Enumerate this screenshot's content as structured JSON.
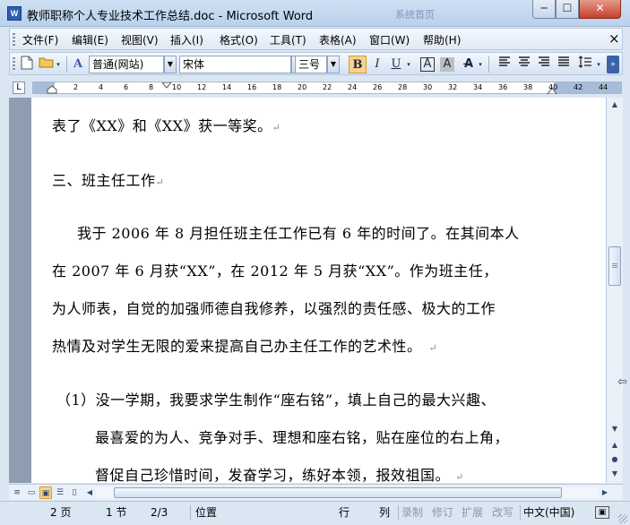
{
  "window": {
    "title": "教师职称个人专业技术工作总结.doc - Microsoft Word",
    "app_icon": "W",
    "bg_ghost": "系统首页",
    "min_label": "─",
    "max_label": "☐",
    "close_label": "✕"
  },
  "menu": {
    "items": [
      "文件(F)",
      "编辑(E)",
      "视图(V)",
      "插入(I)",
      "格式(O)",
      "工具(T)",
      "表格(A)",
      "窗口(W)",
      "帮助(H)"
    ],
    "close_label": "×"
  },
  "toolbar": {
    "style_value": "普通(网站)",
    "font_value": "宋体",
    "size_value": "三号",
    "bold": "B",
    "italic": "I",
    "underline": "U",
    "char_border": "A",
    "char_shading": "A"
  },
  "ruler": {
    "tab_glyph": "L",
    "numbers": [
      "2",
      "4",
      "6",
      "8",
      "10",
      "12",
      "14",
      "16",
      "18",
      "20",
      "22",
      "24",
      "26",
      "28",
      "30",
      "32",
      "34",
      "36",
      "38",
      "40",
      "42",
      "44"
    ]
  },
  "document": {
    "paragraph_mark": "↵",
    "lines": [
      "表了《XX》和《XX》获一等奖。",
      "三、班主任工作",
      "我于 2006 年 8 月担任班主任工作已有 6 年的时间了。在其间本人",
      "在 2007 年 6 月获“XX”，在 2012 年 5 月获“XX”。作为班主任，",
      "为人师表，自觉的加强师德自我修养，以强烈的责任感、极大的工作",
      "热情及对学生无限的爱来提高自己办主任工作的艺术性。",
      "（1）没一学期，我要求学生制作“座右铭”，填上自己的最大兴趣、",
      "最喜爱的为人、竞争对手、理想和座右铭，贴在座位的右上角，",
      "督促自己珍惜时间，发奋学习，练好本领，报效祖国。"
    ]
  },
  "statusbar": {
    "page": "2 页",
    "section": "1 节",
    "page_of": "2/3",
    "position": "位置",
    "line": "行",
    "column": "列",
    "rec": "录制",
    "trk": "修订",
    "ext": "扩展",
    "ovr": "改写",
    "language": "中文(中国)"
  }
}
